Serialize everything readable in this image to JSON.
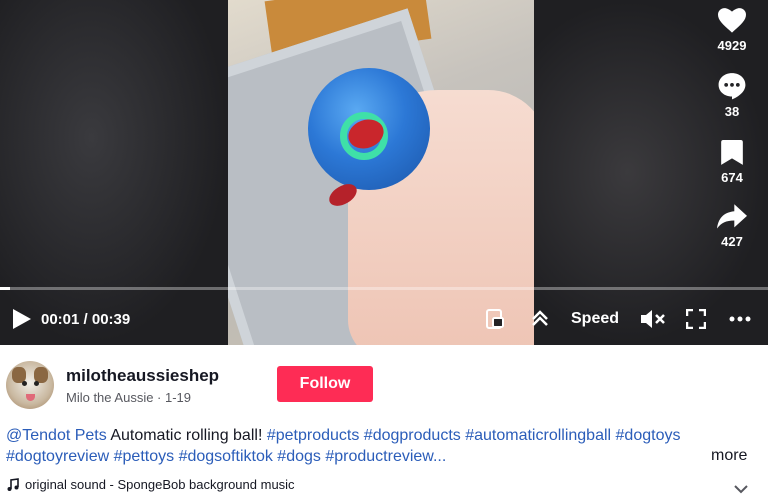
{
  "actions": {
    "likes": "4929",
    "comments": "38",
    "saves": "674",
    "shares": "427"
  },
  "player": {
    "time": "00:01 / 00:39",
    "speed_label": "Speed",
    "progress": 0.013
  },
  "author": {
    "username": "milotheaussieshep",
    "nickname_date": "Milo the Aussie · 1-19",
    "follow_label": "Follow"
  },
  "description": {
    "mention": "@Tendot Pets",
    "text": " Automatic rolling ball! ",
    "hashtags": [
      "#petproducts",
      "#dogproducts",
      "#automaticrollingball",
      "#dogtoys",
      "#dogtoyreview",
      "#pettoys",
      "#dogsoftiktok",
      "#dogs",
      "#productreview..."
    ],
    "more_label": "more"
  },
  "music": {
    "label": "original sound - SpongeBob background music"
  },
  "colors": {
    "follow": "#fe2c55",
    "hashtag": "#2b5db9"
  }
}
